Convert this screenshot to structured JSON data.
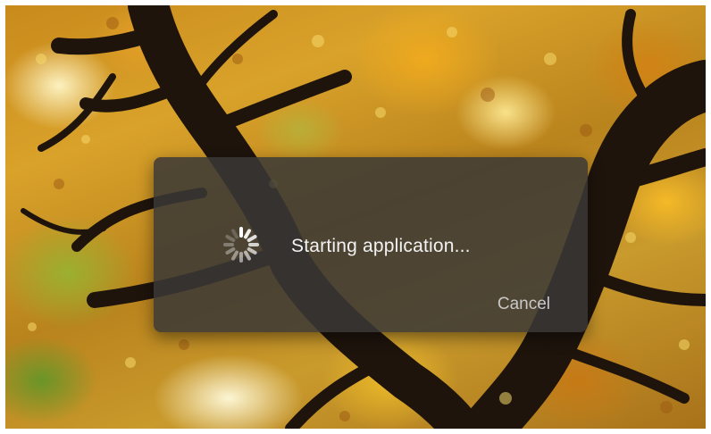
{
  "background": {
    "description_icon": "autumn-tree-wallpaper"
  },
  "dialog": {
    "message": "Starting application...",
    "cancel_label": "Cancel",
    "spinner_icon": "loading-spinner-icon"
  },
  "colors": {
    "dialog_bg": "#3a3836",
    "message_text": "#f2f2f2",
    "cancel_text": "#c8c8c8"
  }
}
